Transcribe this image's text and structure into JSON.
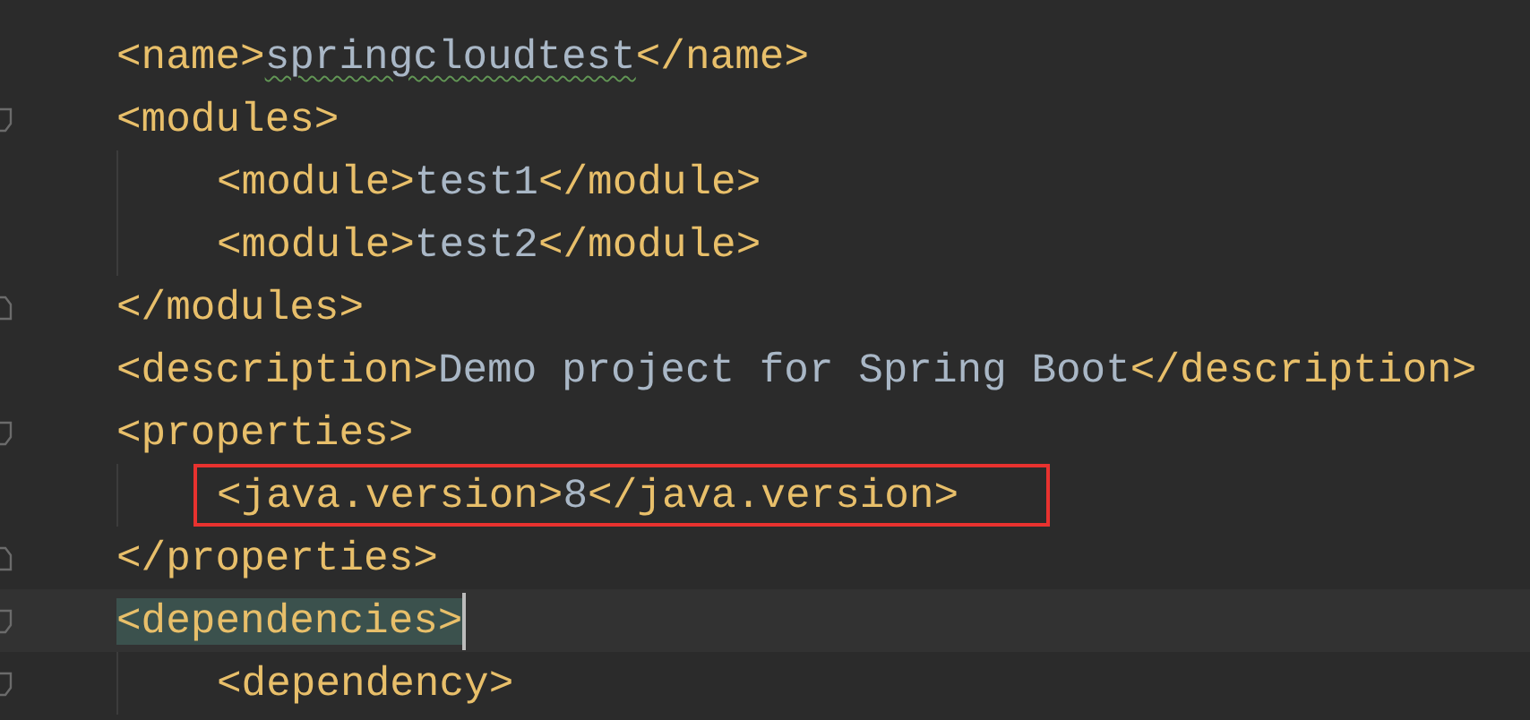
{
  "editor": {
    "lines": [
      {
        "tokens": [
          {
            "kind": "tag",
            "text": "<name>"
          },
          {
            "kind": "value",
            "text": "springcloudtest",
            "typo": true
          },
          {
            "kind": "tag",
            "text": "</name>"
          }
        ]
      },
      {
        "fold_start": true,
        "tokens": [
          {
            "kind": "tag",
            "text": "<modules>"
          }
        ],
        "children": [
          {
            "tokens": [
              {
                "kind": "tag",
                "text": "<module>"
              },
              {
                "kind": "value",
                "text": "test1"
              },
              {
                "kind": "tag",
                "text": "</module>"
              }
            ]
          },
          {
            "tokens": [
              {
                "kind": "tag",
                "text": "<module>"
              },
              {
                "kind": "value",
                "text": "test2"
              },
              {
                "kind": "tag",
                "text": "</module>"
              }
            ]
          }
        ]
      },
      {
        "fold_end": true,
        "tokens": [
          {
            "kind": "tag",
            "text": "</modules>"
          }
        ]
      },
      {
        "tokens": [
          {
            "kind": "tag",
            "text": "<description>"
          },
          {
            "kind": "value",
            "text": "Demo project for Spring Boot"
          },
          {
            "kind": "tag",
            "text": "</description>"
          }
        ]
      },
      {
        "fold_start": true,
        "tokens": [
          {
            "kind": "tag",
            "text": "<properties>"
          }
        ],
        "children": [
          {
            "boxed": true,
            "tokens": [
              {
                "kind": "tag",
                "text": "<java.version>"
              },
              {
                "kind": "value",
                "text": "8"
              },
              {
                "kind": "tag",
                "text": "</java.version>"
              }
            ]
          }
        ]
      },
      {
        "fold_end": true,
        "tokens": [
          {
            "kind": "tag",
            "text": "</properties>"
          }
        ]
      },
      {
        "fold_start": true,
        "current": true,
        "tokens": [
          {
            "kind": "tag",
            "text": "<dependencies>"
          }
        ],
        "children": [
          {
            "fold_start": true,
            "tokens": [
              {
                "kind": "tag",
                "text": "<dependency>"
              }
            ]
          }
        ]
      }
    ]
  }
}
